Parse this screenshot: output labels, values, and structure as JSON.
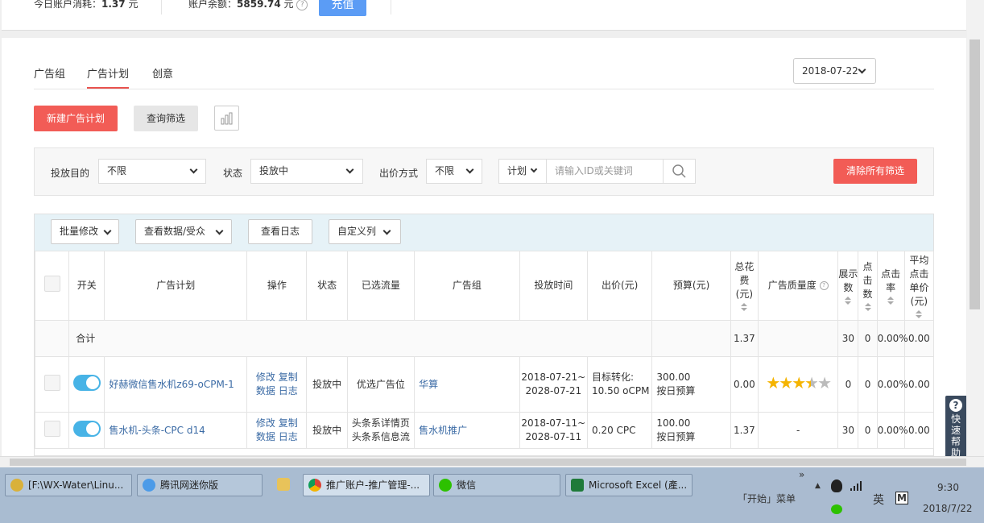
{
  "topbar": {
    "today_label": "今日账户消耗：",
    "today_value": "1.37",
    "today_unit": "元",
    "balance_label": "账户余额：",
    "balance_value": "5859.74",
    "balance_unit": "元",
    "recharge": "充值"
  },
  "tabs": [
    "广告组",
    "广告计划",
    "创意"
  ],
  "date": "2018-07-22",
  "actions": {
    "new_plan": "新建广告计划",
    "query": "查询筛选"
  },
  "filters": {
    "goal_label": "投放目的",
    "goal_value": "不限",
    "status_label": "状态",
    "status_value": "投放中",
    "bid_label": "出价方式",
    "bid_value": "不限",
    "search_prefix": "计划",
    "search_placeholder": "请输入ID或关键词",
    "clear": "清除所有筛选"
  },
  "toolbar": [
    "批量修改",
    "查看数据/受众",
    "查看日志",
    "自定义列"
  ],
  "columns": {
    "switch": "开关",
    "plan": "广告计划",
    "ops": "操作",
    "status": "状态",
    "traffic": "已选流量",
    "group": "广告组",
    "time": "投放时间",
    "bid": "出价(元)",
    "budget": "预算(元)",
    "cost": "总花费(元)",
    "quality": "广告质量度",
    "impr": "展示数",
    "clicks": "点击数",
    "ctr": "点击率",
    "cpc": "平均点击单价(元)"
  },
  "summary": {
    "label": "合计",
    "cost": "1.37",
    "impr": "30",
    "clicks": "0",
    "ctr": "0.00%",
    "cpc": "0.00"
  },
  "rows": [
    {
      "plan": "好赫微信售水机z69-oCPM-1",
      "op1": "修改",
      "op2": "复制",
      "op3": "数据",
      "op4": "日志",
      "status": "投放中",
      "traffic": "优选广告位",
      "group": "华算",
      "time_start": "2018-07-21~",
      "time_end": "2028-07-21",
      "bid": "目标转化: 10.50 oCPM",
      "budget1": "300.00",
      "budget2": "按日预算",
      "cost": "0.00",
      "quality_stars": 3.5,
      "quality_text": "",
      "impr": "0",
      "clicks": "0",
      "ctr": "0.00%",
      "cpc": "0.00"
    },
    {
      "plan": "售水机-头条-CPC d14",
      "op1": "修改",
      "op2": "复制",
      "op3": "数据",
      "op4": "日志",
      "status": "投放中",
      "traffic": "头条系详情页 头条系信息流",
      "group": "售水机推广",
      "time_start": "2018-07-11~",
      "time_end": "2028-07-11",
      "bid": "0.20 CPC",
      "budget1": "100.00",
      "budget2": "按日预算",
      "cost": "1.37",
      "quality_stars": 0,
      "quality_text": "-",
      "impr": "30",
      "clicks": "0",
      "ctr": "0.00%",
      "cpc": "0.00"
    }
  ],
  "help_widget": "快速帮助",
  "taskbar": {
    "items": [
      "[F:\\WX-Water\\Linu...",
      "腾讯网迷你版",
      "推广账户-推广管理-...",
      "微信",
      "Microsoft Excel (產..."
    ],
    "start_menu": "「开始」菜单",
    "ime": "英",
    "time": "9:30",
    "date": "2018/7/22"
  },
  "colors": {
    "accent_red": "#f25c56",
    "link": "#3b6ba5",
    "toggle": "#47b3e6",
    "star": "#f5b400"
  }
}
